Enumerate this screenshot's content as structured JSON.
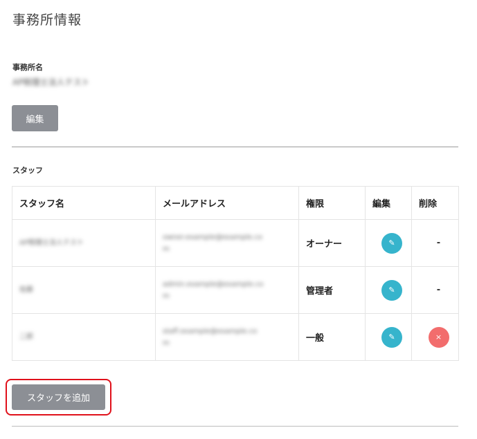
{
  "page": {
    "title": "事務所情報"
  },
  "office": {
    "name_label": "事務所名",
    "name_value": "AP税理士法人テスト",
    "edit_label": "編集"
  },
  "staff_section": {
    "label": "スタッフ",
    "headers": [
      "スタッフ名",
      "メールアドレス",
      "権限",
      "編集",
      "削除"
    ],
    "rows": [
      {
        "name": "AP税理士法人テスト",
        "email_line1": "owner.example@example.co",
        "email_line2": "m",
        "permission": "オーナー",
        "delete": "-"
      },
      {
        "name": "佐藤",
        "email_line1": "admin.example@example.co",
        "email_line2": "m",
        "permission": "管理者",
        "delete": "-"
      },
      {
        "name": "二郎",
        "email_line1": "staff.example@example.co",
        "email_line2": "m",
        "permission": "一般",
        "delete": "×"
      }
    ],
    "add_label": "スタッフを追加"
  },
  "icons": {
    "edit": "edit-pencil-icon",
    "delete": "close-icon"
  },
  "colors": {
    "button_gray": "#8c8f95",
    "edit_blue": "#36b4cc",
    "delete_red": "#f26d6d",
    "highlight": "#e0101a"
  }
}
